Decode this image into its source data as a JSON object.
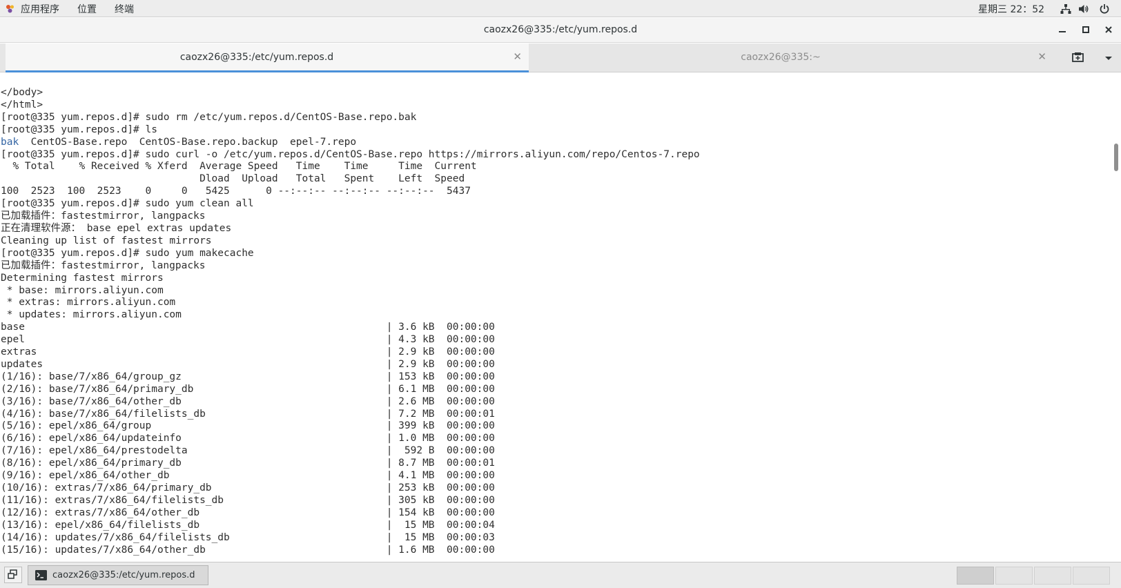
{
  "top_bar": {
    "menus": [
      "应用程序",
      "位置",
      "终端"
    ],
    "clock": "星期三 22：52",
    "tray_icons": [
      "network-icon",
      "volume-icon",
      "power-icon"
    ]
  },
  "window": {
    "title": "caozx26@335:/etc/yum.repos.d",
    "controls": [
      "minimize",
      "maximize",
      "close"
    ]
  },
  "tabs": [
    {
      "label": "caozx26@335:/etc/yum.repos.d",
      "active": true
    },
    {
      "label": "caozx26@335:~",
      "active": false
    }
  ],
  "terminal": {
    "lines": [
      "</body>",
      "</html>",
      "[root@335 yum.repos.d]# sudo rm /etc/yum.repos.d/CentOS-Base.repo.bak",
      "[root@335 yum.repos.d]# ls",
      "",
      "[root@335 yum.repos.d]# sudo curl -o /etc/yum.repos.d/CentOS-Base.repo https://mirrors.aliyun.com/repo/Centos-7.repo",
      "  % Total    % Received % Xferd  Average Speed   Time    Time     Time  Current",
      "                                 Dload  Upload   Total   Spent    Left  Speed",
      "100  2523  100  2523    0     0   5425      0 --:--:-- --:--:-- --:--:--  5437",
      "[root@335 yum.repos.d]# sudo yum clean all",
      "已加载插件：fastestmirror, langpacks",
      "正在清理软件源： base epel extras updates",
      "Cleaning up list of fastest mirrors",
      "[root@335 yum.repos.d]# sudo yum makecache",
      "已加载插件：fastestmirror, langpacks",
      "Determining fastest mirrors",
      " * base: mirrors.aliyun.com",
      " * extras: mirrors.aliyun.com",
      " * updates: mirrors.aliyun.com",
      "base                                                            | 3.6 kB  00:00:00",
      "epel                                                            | 4.3 kB  00:00:00",
      "extras                                                          | 2.9 kB  00:00:00",
      "updates                                                         | 2.9 kB  00:00:00",
      "(1/16): base/7/x86_64/group_gz                                  | 153 kB  00:00:00",
      "(2/16): base/7/x86_64/primary_db                                | 6.1 MB  00:00:00",
      "(3/16): base/7/x86_64/other_db                                  | 2.6 MB  00:00:00",
      "(4/16): base/7/x86_64/filelists_db                              | 7.2 MB  00:00:01",
      "(5/16): epel/x86_64/group                                       | 399 kB  00:00:00",
      "(6/16): epel/x86_64/updateinfo                                  | 1.0 MB  00:00:00",
      "(7/16): epel/x86_64/prestodelta                                 |  592 B  00:00:00",
      "(8/16): epel/x86_64/primary_db                                  | 8.7 MB  00:00:01",
      "(9/16): epel/x86_64/other_db                                    | 4.1 MB  00:00:00",
      "(10/16): extras/7/x86_64/primary_db                             | 253 kB  00:00:00",
      "(11/16): extras/7/x86_64/filelists_db                           | 305 kB  00:00:00",
      "(12/16): extras/7/x86_64/other_db                               | 154 kB  00:00:00",
      "(13/16): epel/x86_64/filelists_db                               |  15 MB  00:00:04",
      "(14/16): updates/7/x86_64/filelists_db                          |  15 MB  00:00:03",
      "(15/16): updates/7/x86_64/other_db                              | 1.6 MB  00:00:00"
    ],
    "ls_output": {
      "directory": "bak",
      "files": "  CentOS-Base.repo  CentOS-Base.repo.backup  epel-7.repo"
    },
    "colors": {
      "text": "#2e2e2e",
      "directory": "#3465a4",
      "background": "#ffffff"
    }
  },
  "taskbar": {
    "window_button": "caozx26@335:/etc/yum.repos.d",
    "workspaces": 4
  },
  "colors": {
    "accent": "#4a90d9"
  }
}
